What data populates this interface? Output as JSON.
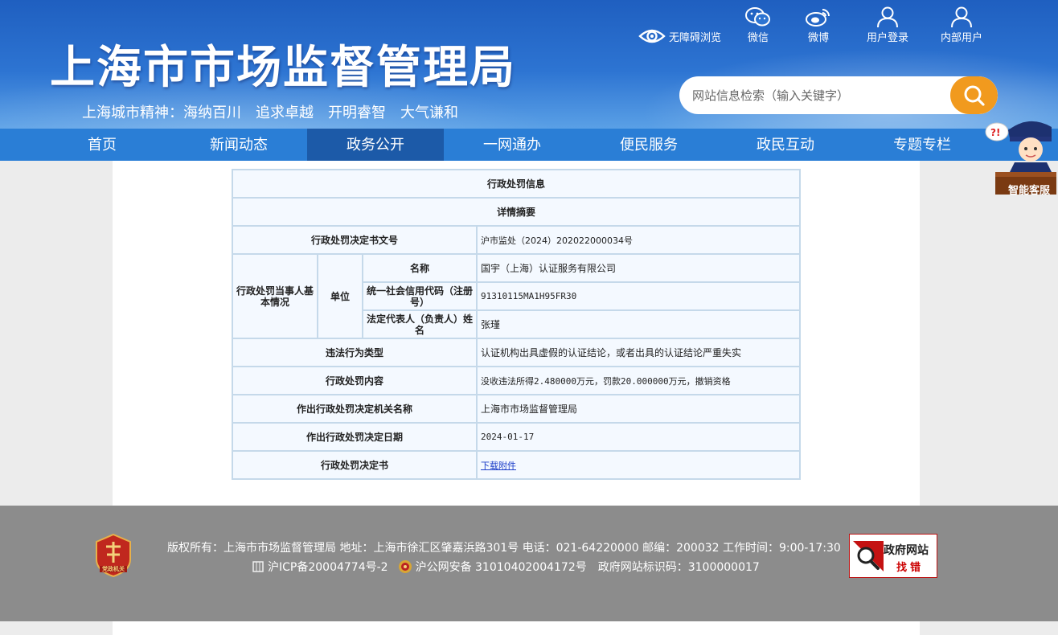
{
  "header": {
    "site_title": "上海市市场监督管理局",
    "slogan": "上海城市精神：海纳百川　追求卓越　开明睿智　大气谦和",
    "accessibility": "无障碍浏览",
    "icons": [
      {
        "label": "微信",
        "icon": "wechat-icon"
      },
      {
        "label": "微博",
        "icon": "weibo-icon"
      },
      {
        "label": "用户登录",
        "icon": "user-icon"
      },
      {
        "label": "内部用户",
        "icon": "user-icon"
      }
    ],
    "search_placeholder": "网站信息检索（输入关键字）"
  },
  "nav": {
    "items": [
      "首页",
      "新闻动态",
      "政务公开",
      "一网通办",
      "便民服务",
      "政民互动",
      "专题专栏"
    ],
    "active": "政务公开"
  },
  "robot": {
    "label": "智能客服"
  },
  "table": {
    "title": "行政处罚信息",
    "subtitle": "详情摘要",
    "doc_no_label": "行政处罚决定书文号",
    "doc_no": "沪市监处（2024）202022000034号",
    "party_label": "行政处罚当事人基本情况",
    "unit_label": "单位",
    "name_label": "名称",
    "name": "国宇（上海）认证服务有限公司",
    "credit_label": "统一社会信用代码（注册号）",
    "credit": "91310115MA1H95FR30",
    "rep_label": "法定代表人（负责人）姓名",
    "rep": "张瑾",
    "type_label": "违法行为类型",
    "type": "认证机构出具虚假的认证结论，或者出具的认证结论严重失实",
    "content_label": "行政处罚内容",
    "content": "没收违法所得2.480000万元，罚款20.000000万元，撤销资格",
    "org_label": "作出行政处罚决定机关名称",
    "org": "上海市市场监督管理局",
    "date_label": "作出行政处罚决定日期",
    "date": "2024-01-17",
    "doc_label": "行政处罚决定书",
    "doc_link": "下载附件"
  },
  "footer": {
    "line1": "版权所有：上海市市场监督管理局 地址：上海市徐汇区肇嘉浜路301号 电话：021-64220000 邮编：200032 工作时间：9:00-17:30",
    "icp": "沪ICP备20004774号-2",
    "police": "沪公网安备 31010402004172号",
    "gov_id": "政府网站标识码：3100000017",
    "emblem_text": "党政机关",
    "jc_line1": "政府网站",
    "jc_line2": "找错"
  },
  "colors": {
    "header_blue": "#2d74d2",
    "nav_blue": "#2a7ed6",
    "nav_active": "#1c5aa8",
    "search_button": "#f19a1e",
    "table_border": "#c5d9ea",
    "table_bg": "#f4f9ff",
    "footer_gray": "#8c8c8c",
    "link_blue": "#1a3cc8"
  }
}
